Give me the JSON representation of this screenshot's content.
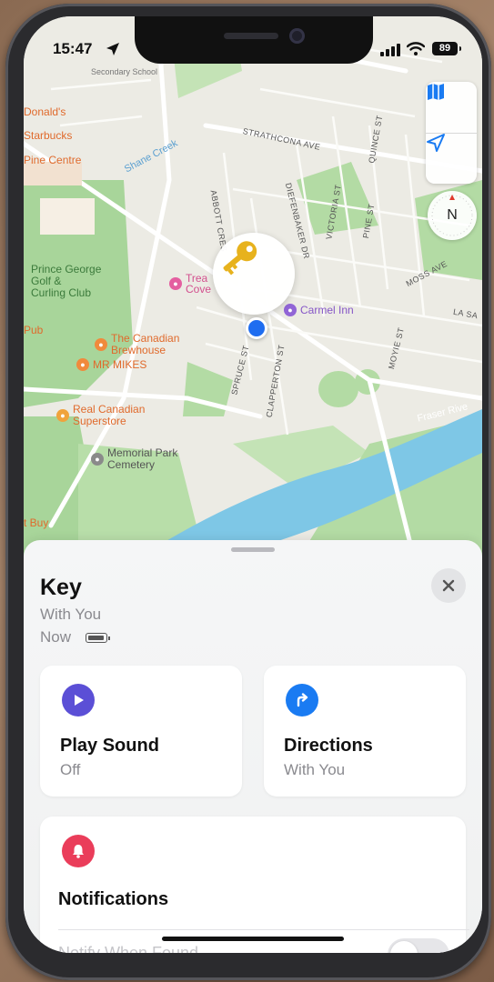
{
  "status_bar": {
    "time": "15:47",
    "battery": "89"
  },
  "map": {
    "labels": {
      "donalds": "Donald's",
      "starbucks": "Starbucks",
      "pine_centre": "Pine Centre",
      "shane_creek": "Shane Creek",
      "golf": "Prince George\nGolf &\nCurling Club",
      "pub": "Pub",
      "canadian_brewhouse": "The Canadian\nBrewhouse",
      "mr_mikes": "MR MIKES",
      "real_canadian": "Real Canadian\nSuperstore",
      "memorial_park": "Memorial Park\nCemetery",
      "best_buy": "t Buy",
      "treasure_cove": "Trea\nCove",
      "carmel_inn": "Carmel Inn",
      "fraser_river": "Fraser Rive",
      "strathcona": "STRATHCONA AVE",
      "quince": "QUINCE ST",
      "pine_st": "PINE ST",
      "victoria": "VICTORIA ST",
      "diefenbaker": "DIEFENBAKER DR",
      "abbott": "ABBOTT CRES",
      "moss": "MOSS AVE",
      "la_salle": "LA SA",
      "moyie": "MOYIE ST",
      "spruce": "SPRUCE ST",
      "clapperton": "CLAPPERTON ST",
      "secondary_school": "Secondary School"
    },
    "compass_label": "N"
  },
  "item": {
    "name": "Key",
    "location": "With You",
    "time": "Now"
  },
  "actions": {
    "play_sound": {
      "label": "Play Sound",
      "value": "Off"
    },
    "directions": {
      "label": "Directions",
      "value": "With You"
    }
  },
  "notifications": {
    "label": "Notifications",
    "notify_when_found": "Notify When Found"
  },
  "colors": {
    "play_icon_bg": "#5b4fd6",
    "directions_icon_bg": "#1a7bf2",
    "notifications_icon_bg": "#ea3d5a",
    "user_dot": "#1f6df0"
  },
  "icons": {
    "status_location": "location-arrow-icon",
    "signal": "signal-bars-icon",
    "wifi": "wifi-icon",
    "map_mode": "map-icon",
    "tracking": "location-arrow-icon",
    "compass": "compass-icon",
    "item": "key-icon",
    "close": "close-icon",
    "play": "play-icon",
    "directions": "turn-right-arrow-icon",
    "bell": "bell-icon"
  }
}
